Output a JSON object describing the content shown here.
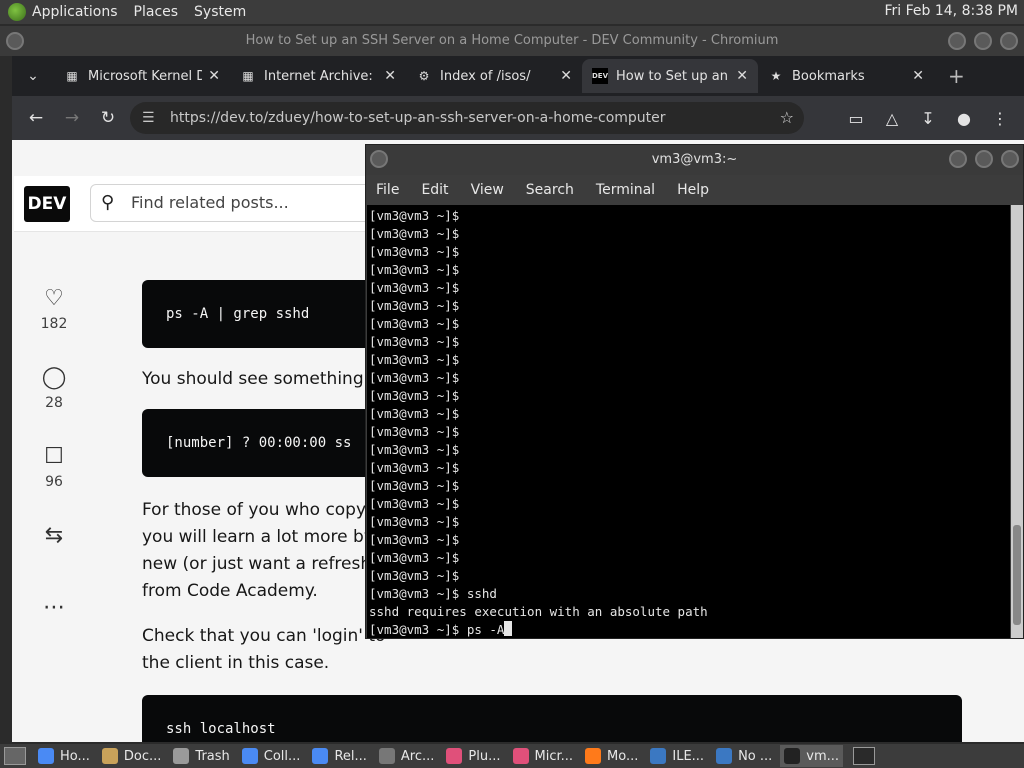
{
  "top_panel": {
    "menus": [
      "Applications",
      "Places",
      "System"
    ],
    "clock": "Fri Feb 14,  8:38 PM"
  },
  "browser": {
    "window_title": "How to Set up an SSH Server on a Home Computer - DEV Community - Chromium",
    "tabs": [
      {
        "label": "Microsoft Kernel D",
        "icon": "archive-icon"
      },
      {
        "label": "Internet Archive: D",
        "icon": "archive-icon"
      },
      {
        "label": "Index of /isos/",
        "icon": "gear-icon"
      },
      {
        "label": "How to Set up an",
        "icon": "dev-icon",
        "active": true
      },
      {
        "label": "Bookmarks",
        "icon": "star-icon"
      }
    ],
    "url": "https://dev.to/zduey/how-to-set-up-an-ssh-server-on-a-home-computer"
  },
  "page": {
    "logo": "DEV",
    "search_placeholder": "Find related posts...",
    "reactions": {
      "likes": "182",
      "comments": "28",
      "saves": "96"
    },
    "code1": "ps -A | grep sshd",
    "para1": "You should see something li",
    "code2": "[number] ?  00:00:00 ss",
    "para2_lines": [
      "For those of you who copy/p",
      "you will learn a lot more by t",
      "new (or just want a refreshe",
      "from Code Academy."
    ],
    "para3_lines": [
      "Check that you can 'login' to",
      "the client in this case."
    ],
    "code3": "ssh localhost"
  },
  "terminal": {
    "title": "vm3@vm3:~",
    "menu": [
      "File",
      "Edit",
      "View",
      "Search",
      "Terminal",
      "Help"
    ],
    "lines": [
      "[vm3@vm3 ~]$",
      "[vm3@vm3 ~]$",
      "[vm3@vm3 ~]$",
      "[vm3@vm3 ~]$",
      "[vm3@vm3 ~]$",
      "[vm3@vm3 ~]$",
      "[vm3@vm3 ~]$",
      "[vm3@vm3 ~]$",
      "[vm3@vm3 ~]$",
      "[vm3@vm3 ~]$",
      "[vm3@vm3 ~]$",
      "[vm3@vm3 ~]$",
      "[vm3@vm3 ~]$",
      "[vm3@vm3 ~]$",
      "[vm3@vm3 ~]$",
      "[vm3@vm3 ~]$",
      "[vm3@vm3 ~]$",
      "[vm3@vm3 ~]$",
      "[vm3@vm3 ~]$",
      "[vm3@vm3 ~]$",
      "[vm3@vm3 ~]$",
      "[vm3@vm3 ~]$ sshd",
      "sshd requires execution with an absolute path"
    ],
    "current_line": "[vm3@vm3 ~]$ ps -A"
  },
  "taskbar": {
    "items": [
      {
        "label": "Ho...",
        "color": "#4a8af4"
      },
      {
        "label": "Doc...",
        "color": "#c9a25a"
      },
      {
        "label": "Trash",
        "color": "#9a9a9a"
      },
      {
        "label": "Coll...",
        "color": "#4a8af4"
      },
      {
        "label": "Rel...",
        "color": "#4a8af4"
      },
      {
        "label": "Arc...",
        "color": "#777777"
      },
      {
        "label": "Plu...",
        "color": "#e0507a"
      },
      {
        "label": "Micr...",
        "color": "#e0507a"
      },
      {
        "label": "Mo...",
        "color": "#ff7a1a"
      },
      {
        "label": "ILE...",
        "color": "#3b78c2"
      },
      {
        "label": "No ...",
        "color": "#3b78c2"
      },
      {
        "label": "vm...",
        "color": "#222222"
      }
    ]
  }
}
